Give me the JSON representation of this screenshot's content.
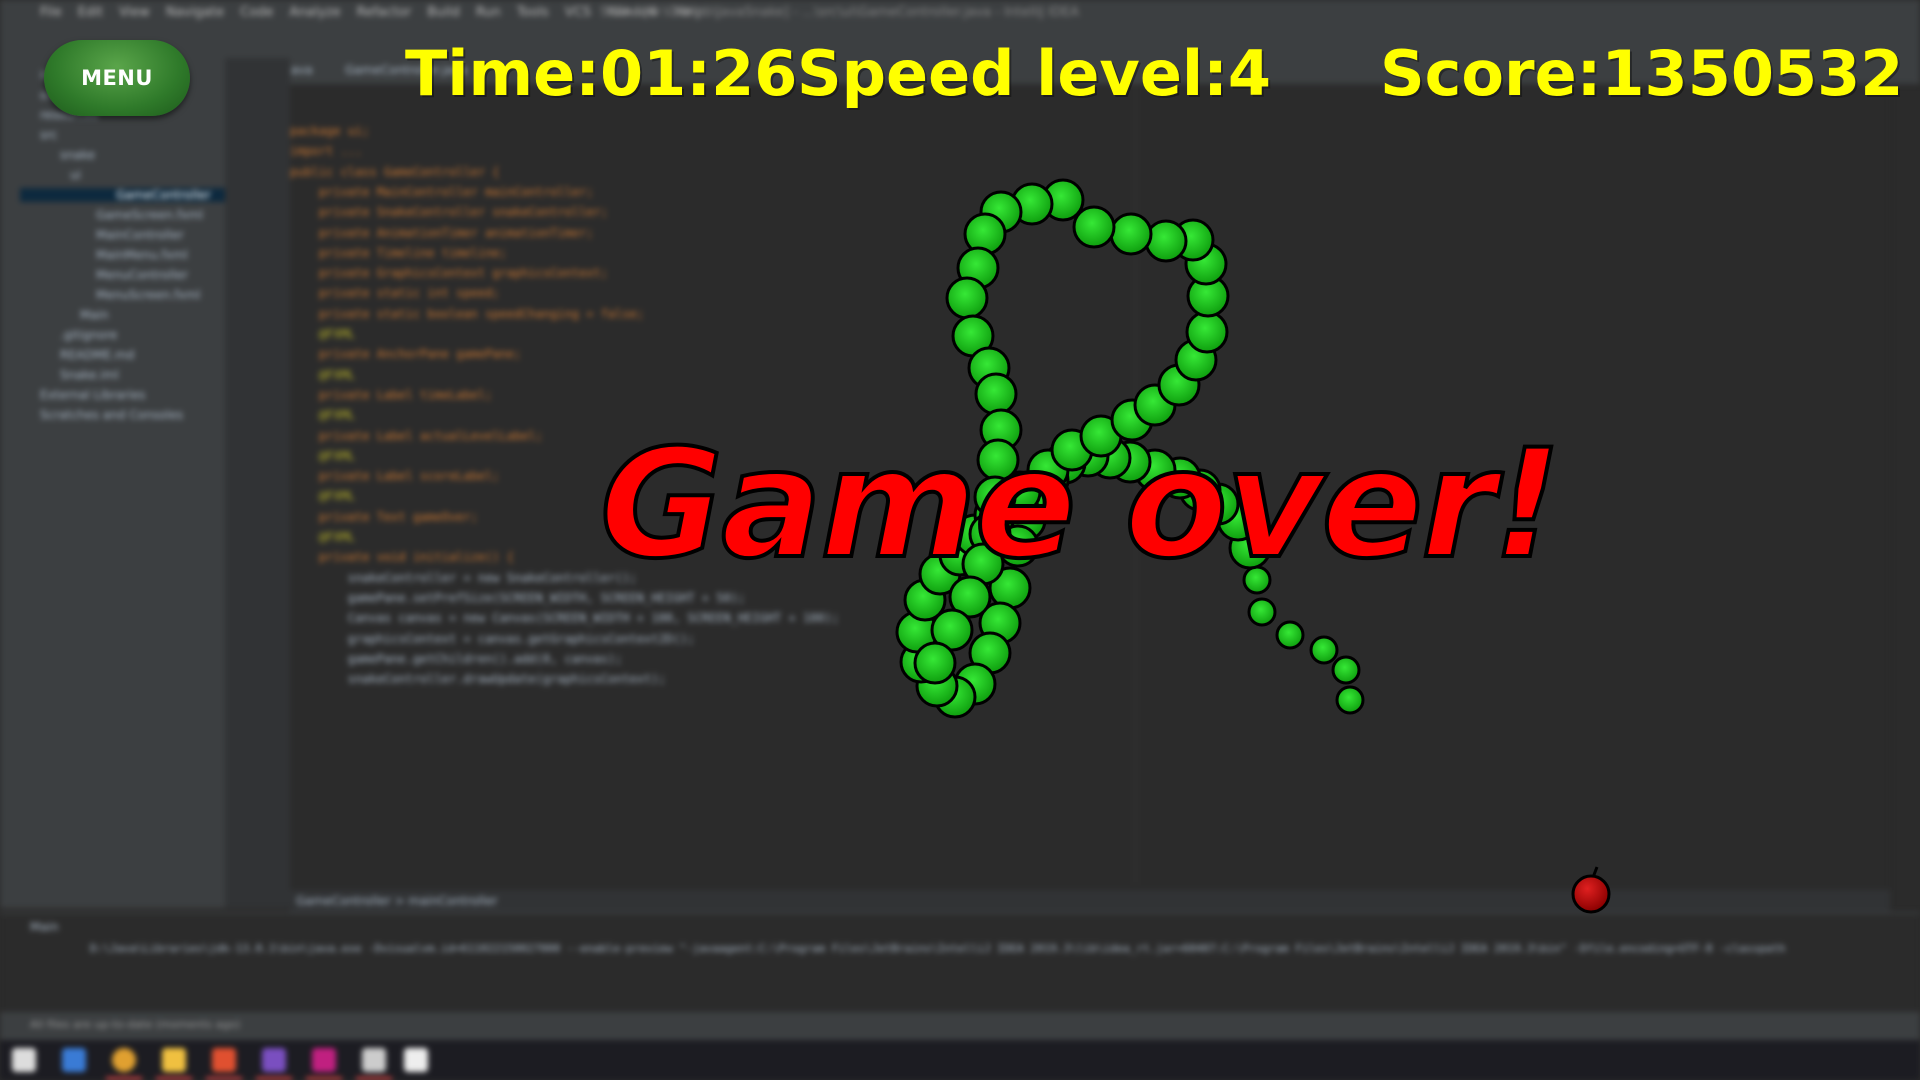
{
  "ide": {
    "menu": [
      "File",
      "Edit",
      "View",
      "Navigate",
      "Code",
      "Analyze",
      "Refactor",
      "Build",
      "Run",
      "Tools",
      "VCS",
      "Window",
      "Help"
    ],
    "title": "Snake [D:\\GitHub\\JavaSnake] - ...\\src\\ui\\GameController.java - IntelliJ IDEA",
    "tabs": [
      "Main.java",
      "GameController.java"
    ],
    "tree": [
      "idea",
      "out",
      "resources",
      "src",
      "snake",
      "ui",
      "GameController",
      "GameScreen.fxml",
      "MainController",
      "MainMenu.fxml",
      "MenuController",
      "MenuScreen.fxml",
      "Main",
      ".gitignore",
      "README.md",
      "Snake.iml",
      "External Libraries",
      "Scratches and Consoles"
    ],
    "code": [
      {
        "cls": "kw",
        "t": "package ui;"
      },
      {
        "cls": "kw",
        "t": "import ..."
      },
      {
        "cls": "kw",
        "t": "public class GameController {"
      },
      {
        "cls": "kw",
        "t": "    private MainController mainController;"
      },
      {
        "cls": "kw",
        "t": "    private SnakeController snakeController;"
      },
      {
        "cls": "kw",
        "t": "    private AnimationTimer animationTimer;"
      },
      {
        "cls": "kw",
        "t": "    private Timeline timeline;"
      },
      {
        "cls": "kw",
        "t": "    private GraphicsContext graphicsContext;"
      },
      {
        "cls": "kw",
        "t": "    private static int speed;"
      },
      {
        "cls": "kw",
        "t": "    private static boolean speedChanging = false;"
      },
      {
        "cls": "an",
        "t": "    @FXML"
      },
      {
        "cls": "kw",
        "t": "    private AnchorPane gamePane;"
      },
      {
        "cls": "an",
        "t": "    @FXML"
      },
      {
        "cls": "kw",
        "t": "    private Label timeLabel;"
      },
      {
        "cls": "an",
        "t": "    @FXML"
      },
      {
        "cls": "kw",
        "t": "    private Label actualLevelLabel;"
      },
      {
        "cls": "an",
        "t": "    @FXML"
      },
      {
        "cls": "kw",
        "t": "    private Label scoreLabel;"
      },
      {
        "cls": "an",
        "t": "    @FXML"
      },
      {
        "cls": "kw",
        "t": "    private Text gameOver;"
      },
      {
        "cls": "an",
        "t": "    @FXML"
      },
      {
        "cls": "kw",
        "t": "    private void initialize() {"
      },
      {
        "cls": "tx",
        "t": "        snakeController = new SnakeController();"
      },
      {
        "cls": "tx",
        "t": "        gamePane.setPrefSize(SCREEN_WIDTH, SCREEN_HEIGHT + 50);"
      },
      {
        "cls": "tx",
        "t": "        Canvas canvas = new Canvas(SCREEN_WIDTH + 100, SCREEN_HEIGHT + 100);"
      },
      {
        "cls": "tx",
        "t": "        graphicsContext = canvas.getGraphicsContext2D();"
      },
      {
        "cls": "tx",
        "t": "        gamePane.getChildren().add(0, canvas);"
      },
      {
        "cls": "tx",
        "t": "        snakeController.drawUpdate(graphicsContext);"
      }
    ],
    "breadcrumb": "GameController  >  mainController",
    "run_cmd": "D:\\Java\\Libraries\\jdk-13.0.1\\bin\\java.exe -Dvisualvm.id=611022150027000 --enable-preview \"-javaagent:C:\\Program Files\\JetBrains\\IntelliJ IDEA 2019.3\\lib\\idea_rt.jar=60407:C:\\Program Files\\JetBrains\\IntelliJ IDEA 2019.3\\bin\" -Dfile.encoding=UTF-8 -classpath",
    "run_tab": "Main",
    "status": "All files are up-to-date (moments ago)"
  },
  "hud": {
    "menu_label": "MENU",
    "time_text": "Time:01:26",
    "speed_text": "Speed level:4",
    "score_text": "Score:1350532"
  },
  "game_over_text": "Game over!",
  "colors": {
    "hud_text": "#ffff00",
    "game_over": "#ff0000",
    "snake": "#1ecf1e",
    "apple": "#c40000"
  },
  "icons": [
    "menu-button",
    "apple-icon",
    "snake"
  ]
}
